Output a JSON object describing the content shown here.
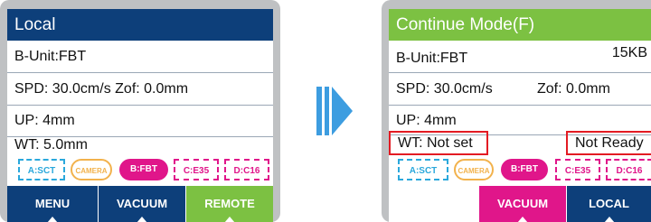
{
  "left_screen": {
    "title": "Local",
    "rows": [
      "B-Unit:FBT",
      "SPD: 30.0cm/s Zof: 0.0mm",
      "UP: 4mm",
      "WT: 5.0mm"
    ],
    "chips": [
      "A:SCT",
      "CAMERA",
      "B:FBT",
      "C:E35",
      "D:C16"
    ],
    "buttons": [
      "MENU",
      "VACUUM",
      "REMOTE"
    ]
  },
  "right_screen": {
    "title": "Continue Mode(F)",
    "size_label": "15KB",
    "unit": "B-Unit:FBT",
    "spd": "SPD: 30.0cm/s",
    "zof": "Zof: 0.0mm",
    "up": "UP: 4mm",
    "wt": "WT: Not set",
    "status": "Not Ready",
    "chips": [
      "A:SCT",
      "CAMERA",
      "B:FBT",
      "C:E35",
      "D:C16"
    ],
    "buttons": [
      "VACUUM",
      "LOCAL"
    ]
  },
  "colors": {
    "navy": "#0d3f7a",
    "green": "#7cc142",
    "pink": "#e0168a",
    "cyan": "#2aa8dc",
    "orange": "#f2b24c",
    "red": "#e31b23",
    "arrow": "#3d9de0"
  }
}
